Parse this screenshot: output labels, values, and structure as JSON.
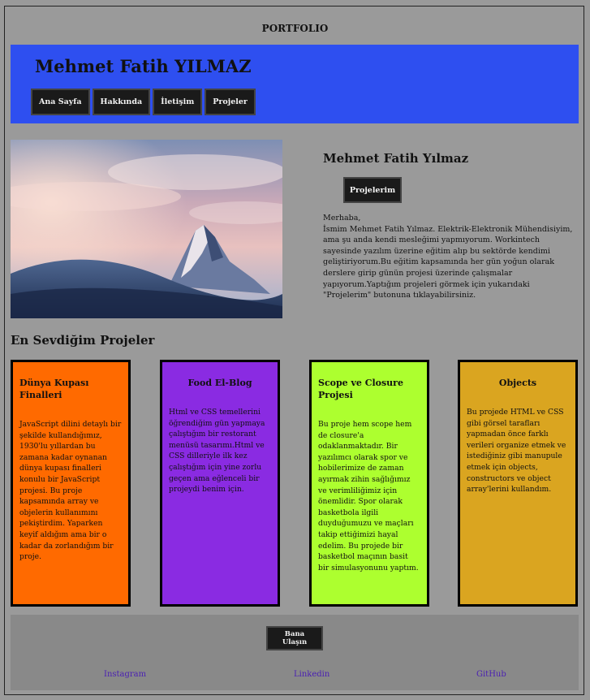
{
  "header": {
    "portfolio_title": "PORTFOLIO",
    "name": "Mehmet Fatih YILMAZ",
    "nav": [
      "Ana Sayfa",
      "Hakkında",
      "İletişim",
      "Projeler"
    ]
  },
  "hero": {
    "image": "mountain-photo",
    "name": "Mehmet Fatih Yılmaz",
    "button": "Projelerim",
    "greeting": "Merhaba,",
    "intro": "İsmim Mehmet Fatih Yılmaz. Elektrik-Elektronik Mühendisiyim, ama şu anda kendi mesleğimi yapmıyorum. Workintech sayesinde yazılım üzerine eğitim alıp bu sektörde kendimi geliştiriyorum.Bu eğitim kapsamında her gün yoğun olarak derslere girip günün projesi üzerinde çalışmalar yapıyorum.Yaptığım projeleri görmek için yukarıdaki \"Projelerim\" butonuna tıklayabilirsiniz."
  },
  "projects": {
    "title": "En Sevdiğim Projeler",
    "cards": [
      {
        "title": "Dünya Kupası Finalleri",
        "color": "#ff6a00",
        "text": "JavaScript dilini detaylı bir şekilde kullandığımız, 1930'lu yıllardan bu zamana kadar oynanan dünya kupası finalleri konulu bir JavaScript projesi. Bu proje kapsamında array ve objelerin kullanımını pekiştirdim. Yaparken keyif aldığım ama bir o kadar da zorlandığım bir proje."
      },
      {
        "title": "Food El-Blog",
        "color": "#8a2be2",
        "text": "Html ve CSS temellerini öğrendiğim gün yapmaya çalıştığım bir restorant menüsü tasarımı.Html ve CSS dilleriyle ilk kez çalıştığım için yine zorlu geçen ama eğlenceli bir projeydi benim için."
      },
      {
        "title": "Scope ve Closure Projesi",
        "color": "#adff2f",
        "text": "Bu proje hem scope hem de closure'a odaklanmaktadır. Bir yazılımcı olarak spor ve hobilerimize de zaman ayırmak zihin sağlığımız ve verimliliğimiz için önemlidir. Spor olarak basketbola ilgili duyduğumuzu ve maçları takip ettiğimizi hayal edelim. Bu projede bir basketbol maçının basit bir simulasyonunu yaptım."
      },
      {
        "title": "Objects",
        "color": "#daa520",
        "text": "Bu projede HTML ve CSS gibi görsel tarafları yapmadan önce farklı verileri organize etmek ve istediğiniz gibi manupule etmek için objects, constructors ve object array'lerini kullandım."
      }
    ]
  },
  "footer": {
    "button": "Bana Ulaşın",
    "links": [
      "Instagram",
      "Linkedin",
      "GitHub"
    ]
  }
}
